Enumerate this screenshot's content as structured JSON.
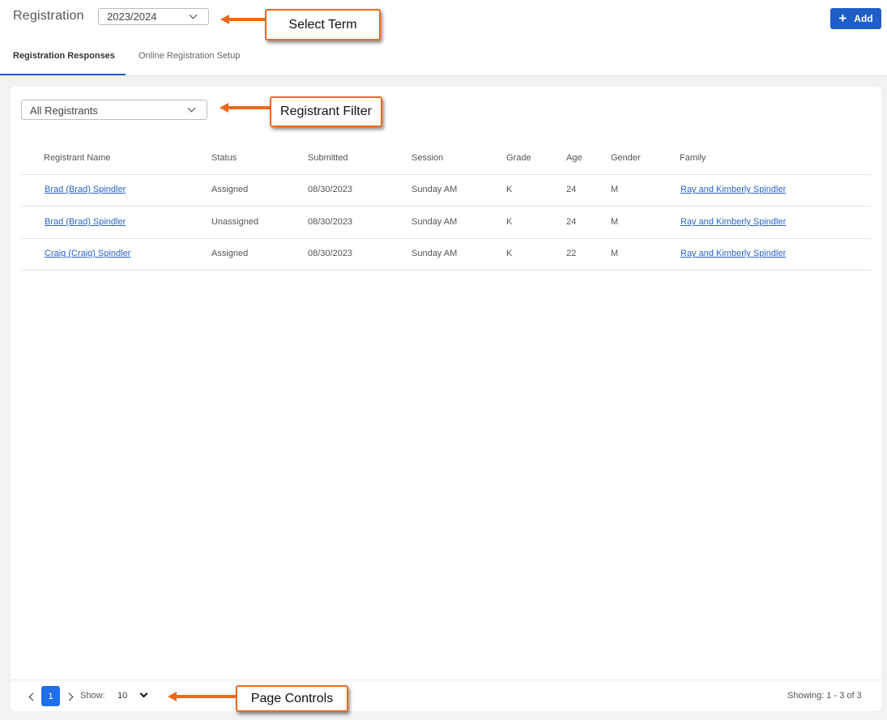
{
  "header": {
    "title": "Registration",
    "term_value": "2023/2024",
    "add_label": "Add"
  },
  "tabs": [
    {
      "label": "Registration Responses",
      "active": true
    },
    {
      "label": "Online Registration Setup",
      "active": false
    }
  ],
  "filter": {
    "value": "All Registrants"
  },
  "table": {
    "columns": [
      "Registrant Name",
      "Status",
      "Submitted",
      "Session",
      "Grade",
      "Age",
      "Gender",
      "Family"
    ],
    "rows": [
      {
        "name": "Brad (Brad) Spindler",
        "status": "Assigned",
        "submitted": "08/30/2023",
        "session": "Sunday AM",
        "grade": "K",
        "age": "24",
        "gender": "M",
        "family": "Ray and Kimberly Spindler"
      },
      {
        "name": "Brad (Brad) Spindler",
        "status": "Unassigned",
        "submitted": "08/30/2023",
        "session": "Sunday AM",
        "grade": "K",
        "age": "24",
        "gender": "M",
        "family": "Ray and Kimberly Spindler"
      },
      {
        "name": "Craig (Craig) Spindler",
        "status": "Assigned",
        "submitted": "08/30/2023",
        "session": "Sunday AM",
        "grade": "K",
        "age": "22",
        "gender": "M",
        "family": "Ray and Kimberly Spindler"
      }
    ]
  },
  "pagination": {
    "current_page": "1",
    "show_label": "Show:",
    "page_size": "10",
    "showing_text": "Showing: 1 - 3 of 3"
  },
  "callouts": {
    "select_term": "Select Term",
    "registrant_filter": "Registrant Filter",
    "page_controls": "Page Controls"
  },
  "colors": {
    "primary": "#1f5ec7",
    "page_active": "#1f6fe5",
    "link": "#2a63c9",
    "callout": "#ea6a1e"
  },
  "icons": [
    "chevron-down-icon",
    "plus-icon",
    "chevron-left-icon",
    "chevron-right-icon",
    "arrow-left-icon"
  ]
}
